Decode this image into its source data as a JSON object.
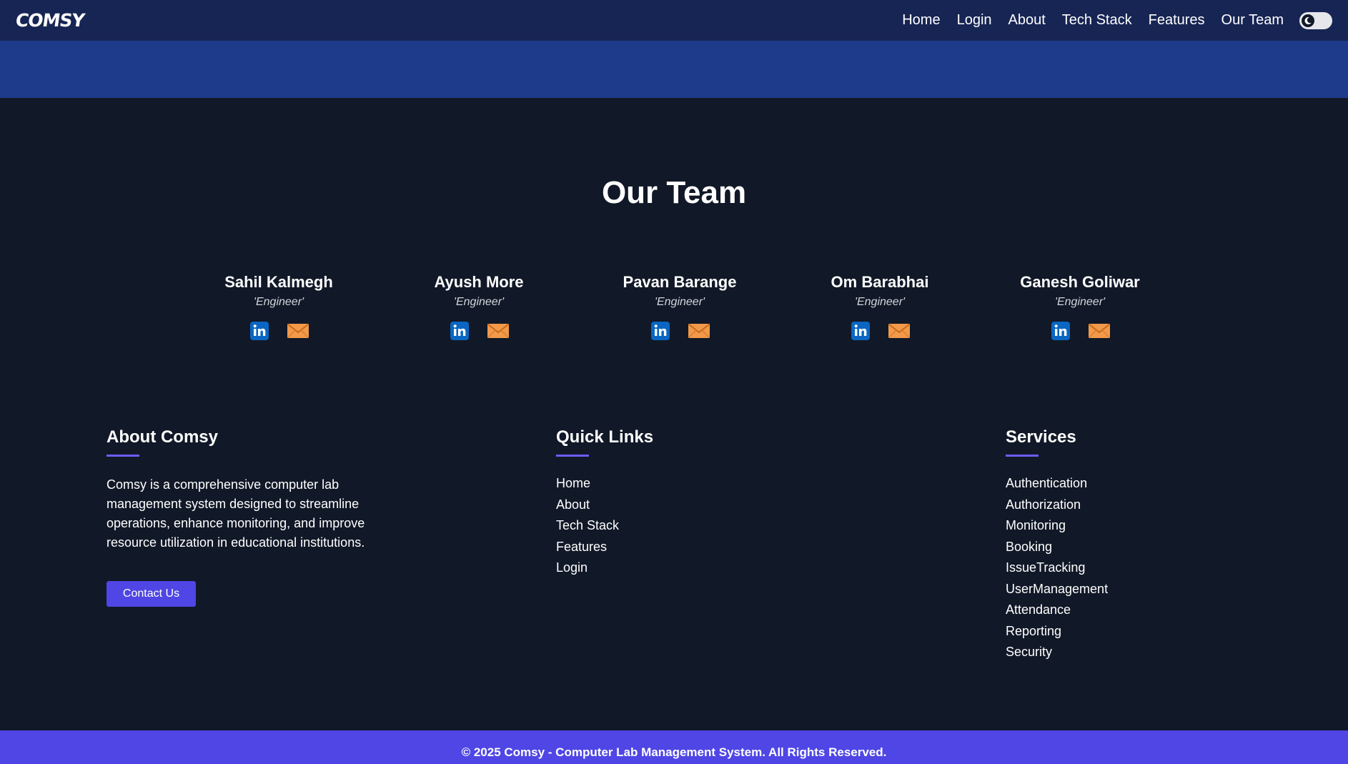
{
  "brand": {
    "logo_text": "COMSY"
  },
  "nav": {
    "links": [
      "Home",
      "Login",
      "About",
      "Tech Stack",
      "Features",
      "Our Team"
    ]
  },
  "team": {
    "title": "Our Team",
    "members": [
      {
        "name": "Sahil Kalmegh",
        "role": "'Engineer'"
      },
      {
        "name": "Ayush More",
        "role": "'Engineer'"
      },
      {
        "name": "Pavan Barange",
        "role": "'Engineer'"
      },
      {
        "name": "Om Barabhai",
        "role": "'Engineer'"
      },
      {
        "name": "Ganesh Goliwar",
        "role": "'Engineer'"
      }
    ]
  },
  "footer": {
    "about": {
      "heading": "About Comsy",
      "text": "Comsy is a comprehensive computer lab management system designed to streamline operations, enhance monitoring, and improve resource utilization in educational institutions.",
      "button": "Contact Us"
    },
    "quick_links": {
      "heading": "Quick Links",
      "items": [
        "Home",
        "About",
        "Tech Stack",
        "Features",
        "Login"
      ]
    },
    "services": {
      "heading": "Services",
      "items": [
        "Authentication",
        "Authorization",
        "Monitoring",
        "Booking",
        "IssueTracking",
        "UserManagement",
        "Attendance",
        "Reporting",
        "Security"
      ]
    },
    "copyright": "© 2025 Comsy - Computer Lab Management System. All Rights Reserved."
  },
  "colors": {
    "page_bg": "#111827",
    "navbar_bg": "#172554",
    "hero_bg": "#1e3a8a",
    "accent": "#4f46e5",
    "linkedin_blue": "#0a66c2",
    "mail_orange": "#f2994a"
  },
  "icons": {
    "theme": "moon-icon",
    "linkedin": "linkedin-icon",
    "mail": "mail-icon"
  }
}
